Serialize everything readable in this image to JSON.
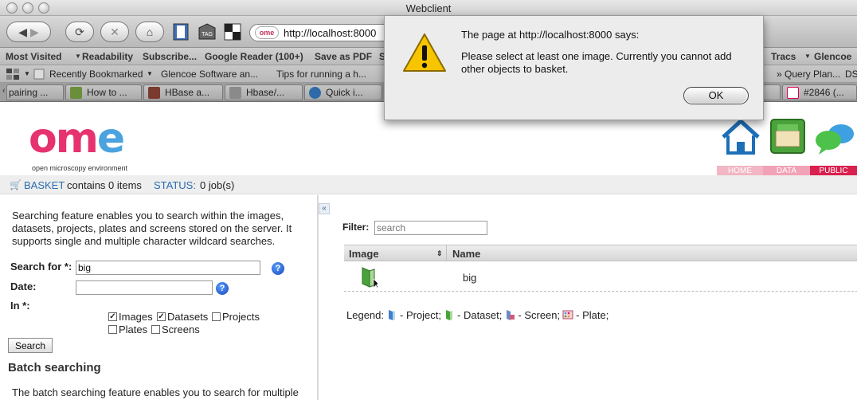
{
  "window": {
    "title": "Webclient"
  },
  "browser": {
    "url": "http://localhost:8000",
    "bookmarks": [
      "Most Visited",
      "Readability",
      "Subscribe...",
      "Google Reader (100+)",
      "Save as PDF",
      "S",
      "Tracs",
      "Glencoe"
    ],
    "bookmarks2": [
      "Recently Bookmarked",
      "Glencoe Software an...",
      "Tips for running a h...",
      "» Query Plan...",
      "DS"
    ],
    "tabs": [
      "pairing ...",
      "How to ...",
      "HBase a...",
      "Hbase/...",
      "Quick i...",
      "#2846 (..."
    ]
  },
  "logo": {
    "word_o": "o",
    "word_m": "m",
    "word_e": "e",
    "subtitle": "open microscopy environment"
  },
  "nav": {
    "home": "HOME",
    "data": "DATA",
    "public": "PUBLIC"
  },
  "status": {
    "basket_label": "BASKET",
    "basket_text": "contains 0 items",
    "status_label": "STATUS:",
    "status_text": "0 job(s)"
  },
  "search": {
    "description": "Searching feature enables you to search within the images, datasets, projects, plates and screens stored on the server. It supports single and multiple character wildcard searches.",
    "search_for_label": "Search for *:",
    "search_for_value": "big",
    "date_label": "Date:",
    "date_value": "",
    "in_label": "In *:",
    "options": [
      {
        "label": "Images",
        "checked": true
      },
      {
        "label": "Datasets",
        "checked": true
      },
      {
        "label": "Projects",
        "checked": false
      },
      {
        "label": "Plates",
        "checked": false
      },
      {
        "label": "Screens",
        "checked": false
      }
    ],
    "button": "Search",
    "batch_title": "Batch searching",
    "batch_desc": "The batch searching feature enables you to search for multiple"
  },
  "results": {
    "filter_label": "Filter:",
    "filter_placeholder": "search",
    "col_image": "Image",
    "col_name": "Name",
    "rows": [
      {
        "name": "big"
      }
    ],
    "legend_label": "Legend:",
    "legend_project": "- Project;",
    "legend_dataset": "- Dataset;",
    "legend_screen": "- Screen;",
    "legend_plate": "- Plate;"
  },
  "dialog": {
    "title": "The page at http://localhost:8000 says:",
    "message": "Please select at least one image. Currently you cannot add other objects to basket.",
    "ok": "OK"
  }
}
